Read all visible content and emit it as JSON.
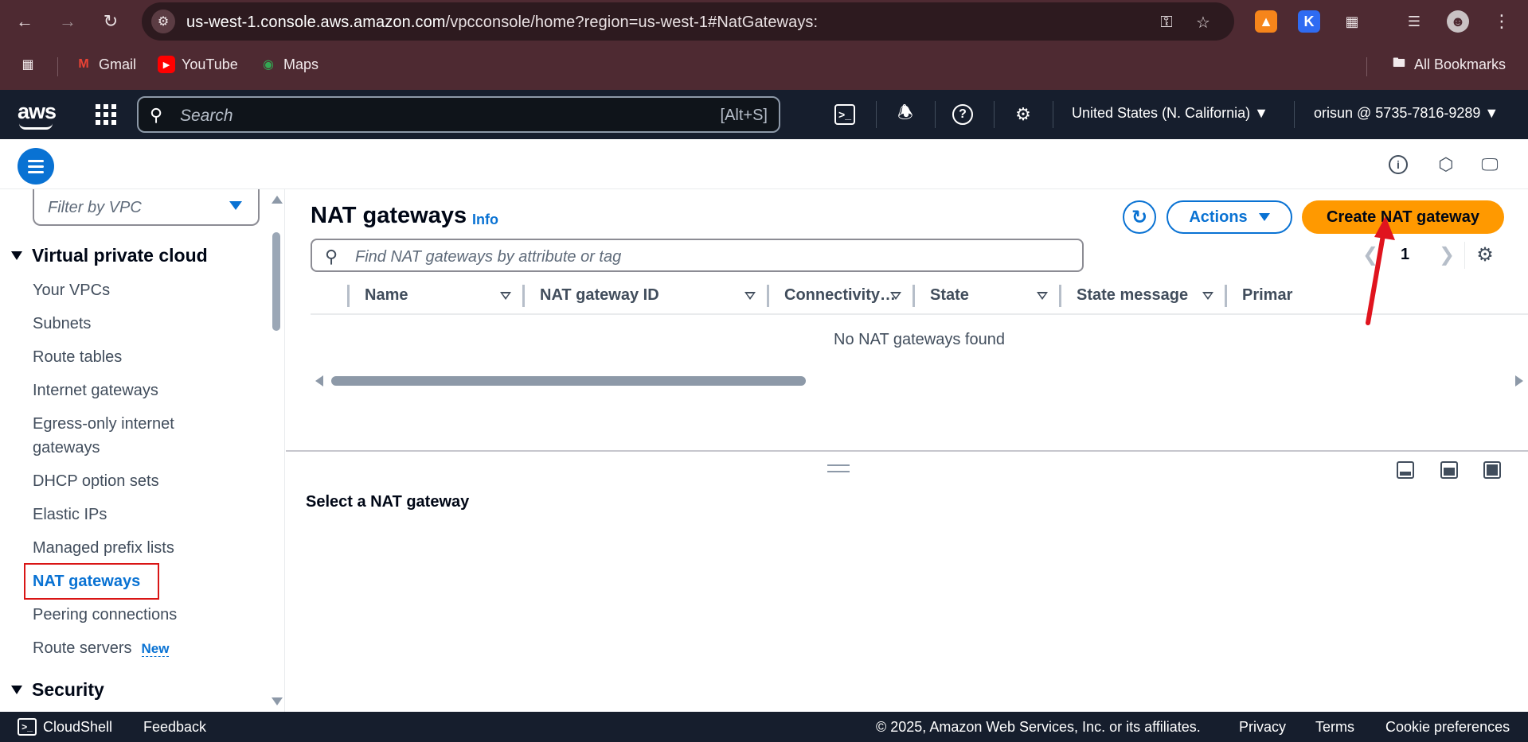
{
  "browser": {
    "url_host": "us-west-1.console.aws.amazon.com",
    "url_rest": "/vpcconsole/home?region=us-west-1#NatGateways:",
    "bookmarks": [
      {
        "label": "Gmail"
      },
      {
        "label": "YouTube"
      },
      {
        "label": "Maps"
      }
    ],
    "all_bookmarks": "All Bookmarks"
  },
  "aws_header": {
    "logo": "aws",
    "search_placeholder": "Search",
    "search_shortcut": "[Alt+S]",
    "region": "United States (N. California)",
    "account": "orisun @ 5735-7816-9289"
  },
  "sidenav": {
    "filter_placeholder": "Filter by VPC",
    "section_vpc": "Virtual private cloud",
    "items": [
      {
        "label": "Your VPCs"
      },
      {
        "label": "Subnets"
      },
      {
        "label": "Route tables"
      },
      {
        "label": "Internet gateways"
      },
      {
        "label": "Egress-only internet gateways"
      },
      {
        "label": "DHCP option sets"
      },
      {
        "label": "Elastic IPs"
      },
      {
        "label": "Managed prefix lists"
      },
      {
        "label": "NAT gateways"
      },
      {
        "label": "Peering connections"
      },
      {
        "label": "Route servers",
        "badge": "New"
      }
    ],
    "section_security": "Security"
  },
  "main": {
    "title": "NAT gateways",
    "info": "Info",
    "actions_label": "Actions",
    "create_label": "Create NAT gateway",
    "find_placeholder": "Find NAT gateways by attribute or tag",
    "page_number": "1",
    "columns": [
      "Name",
      "NAT gateway ID",
      "Connectivity…",
      "State",
      "State message",
      "Primar"
    ],
    "empty_message": "No NAT gateways found",
    "split_title": "Select a NAT gateway"
  },
  "footer": {
    "cloudshell": "CloudShell",
    "feedback": "Feedback",
    "copyright": "© 2025, Amazon Web Services, Inc. or its affiliates.",
    "privacy": "Privacy",
    "terms": "Terms",
    "cookies": "Cookie preferences"
  },
  "colors": {
    "chrome_bar": "#4e2a32",
    "aws_header": "#161e2d",
    "primary_blue": "#0972d3",
    "create_orange": "#ff9900",
    "annotation_red": "#d91515"
  }
}
